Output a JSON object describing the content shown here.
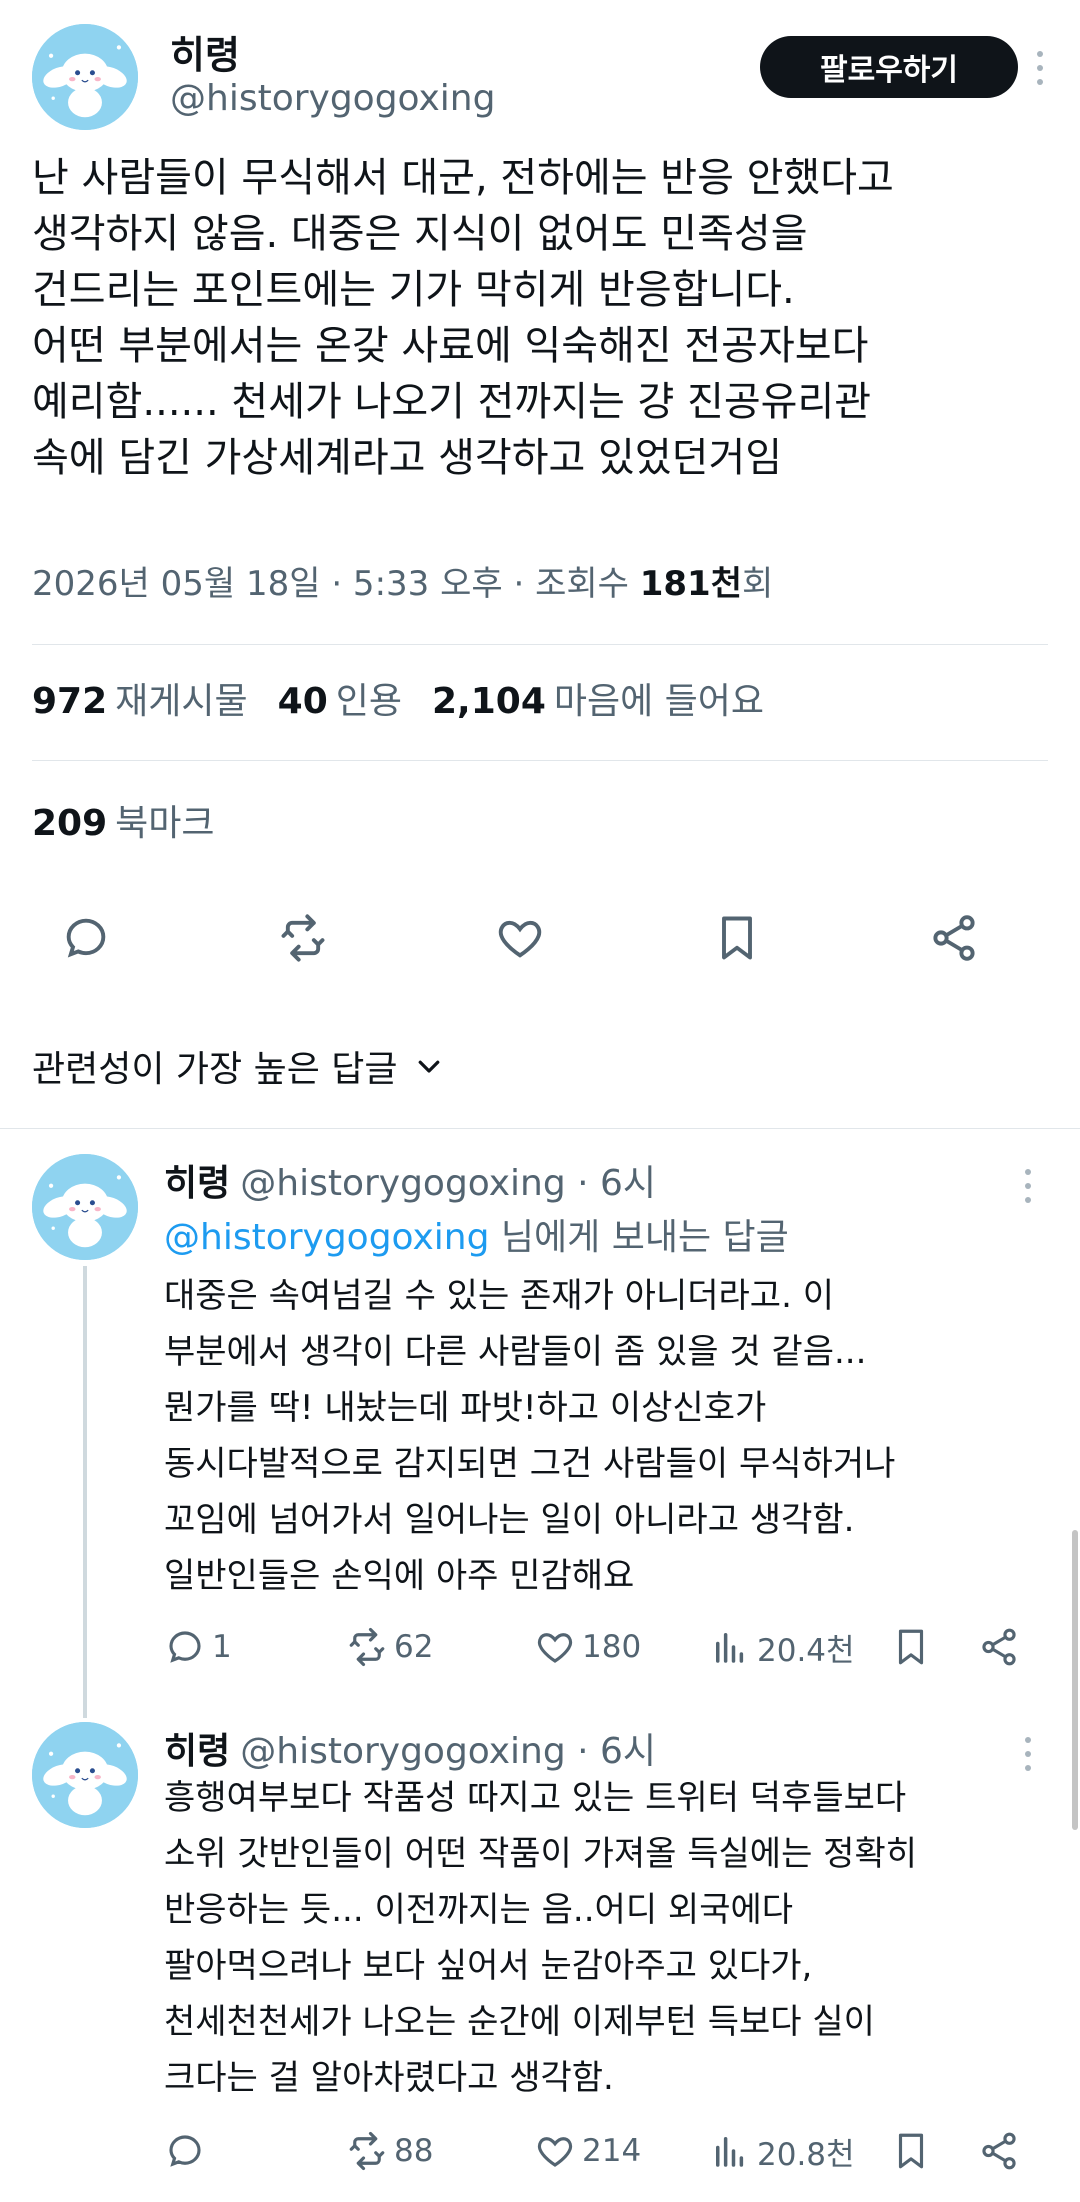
{
  "tweet": {
    "author_name": "히령",
    "author_handle": "@historygogoxing",
    "follow_label": "팔로우하기",
    "text": "난 사람들이 무식해서 대군, 전하에는 반응 안했다고\n생각하지 않음. 대중은 지식이 없어도 민족성을\n건드리는 포인트에는 기가 막히게 반응합니다.\n어떤 부분에서는 온갖 사료에 익숙해진 전공자보다\n예리함...... 천세가 나오기 전까지는 걍 진공유리관\n속에 담긴 가상세계라고 생각하고 있었던거임",
    "meta_prefix": "2026년 05월 18일 · 5:33 오후 · 조회수 ",
    "views": "181천",
    "views_suffix": "회",
    "retweets": "972",
    "retweets_label": "재게시물",
    "quotes": "40",
    "quotes_label": "인용",
    "likes": "2,104",
    "likes_label": "마음에 들어요",
    "bookmarks": "209",
    "bookmarks_label": "북마크"
  },
  "sort_label": "관련성이 가장 높은 답글",
  "replies": [
    {
      "name": "히령",
      "handle_time": "@historygogoxing · 6시",
      "reply_to_handle": "@historygogoxing",
      "reply_to_suffix": " 님에게 보내는 답글",
      "text": "대중은 속여넘길 수 있는 존재가 아니더라고. 이\n부분에서 생각이 다른 사람들이 좀 있을 것 같음...\n뭔가를 딱! 내놨는데 파밧!하고 이상신호가\n동시다발적으로 감지되면 그건 사람들이 무식하거나\n꼬임에 넘어가서 일어나는 일이 아니라고 생각함.\n일반인들은 손익에 아주 민감해요",
      "replies": "1",
      "retweets": "62",
      "likes": "180",
      "views": "20.4천"
    },
    {
      "name": "히령",
      "handle_time": "@historygogoxing · 6시",
      "text": "흥행여부보다 작품성 따지고 있는 트위터 덕후들보다\n소위 갓반인들이 어떤 작품이 가져올 득실에는 정확히\n반응하는 듯... 이전까지는 음..어디 외국에다\n팔아먹으려나 보다 싶어서 눈감아주고 있다가,\n천세천천세가 나오는 순간에 이제부턴 득보다 실이\n크다는 걸 알아차렸다고 생각함.",
      "replies": "",
      "retweets": "88",
      "likes": "214",
      "views": "20.8천"
    }
  ],
  "icons": {
    "reply": "reply-icon",
    "retweet": "retweet-icon",
    "like": "heart-icon",
    "bookmark": "bookmark-icon",
    "share": "share-icon",
    "views": "views-icon",
    "more": "more-icon",
    "sort": "chevron-down-icon"
  },
  "colors": {
    "link": "#1d9bf0",
    "muted": "#536471",
    "follow_button": "#0f1419",
    "avatar_bg": "#8fd3f0"
  }
}
